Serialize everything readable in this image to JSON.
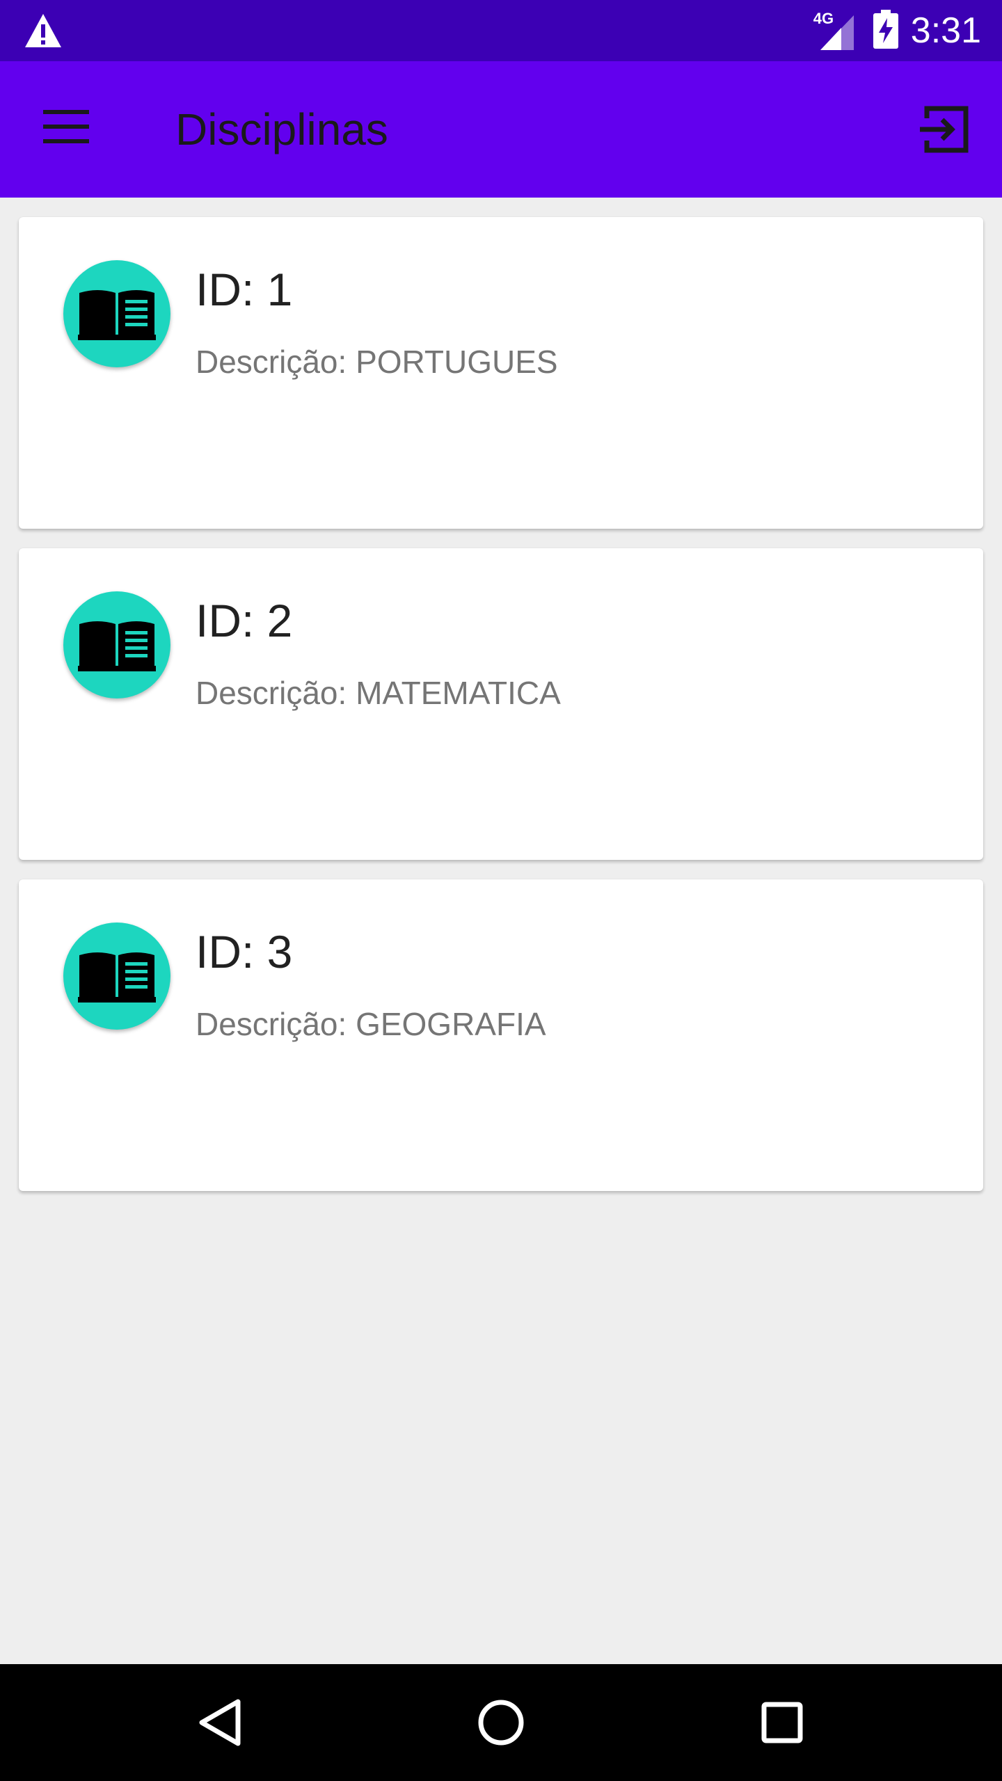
{
  "status_bar": {
    "network": "4G",
    "time": "3:31",
    "icons": [
      "alert-icon",
      "signal-icon",
      "battery-charging-icon"
    ]
  },
  "app_bar": {
    "title": "Disciplinas",
    "menu_icon": "hamburger-menu-icon",
    "exit_icon": "exit-to-app-icon",
    "color": "#6200ee",
    "status_color": "#3c00b4"
  },
  "disciplinas": [
    {
      "id": "ID: 1",
      "descricao": "Descrição: PORTUGUES",
      "icon": "book-icon"
    },
    {
      "id": "ID: 2",
      "descricao": "Descrição: MATEMATICA",
      "icon": "book-icon"
    },
    {
      "id": "ID: 3",
      "descricao": "Descrição: GEOGRAFIA",
      "icon": "book-icon"
    }
  ],
  "avatar_color": "#1dd6bf",
  "nav_bar": {
    "icons": [
      "back-icon",
      "home-icon",
      "recents-icon"
    ]
  }
}
